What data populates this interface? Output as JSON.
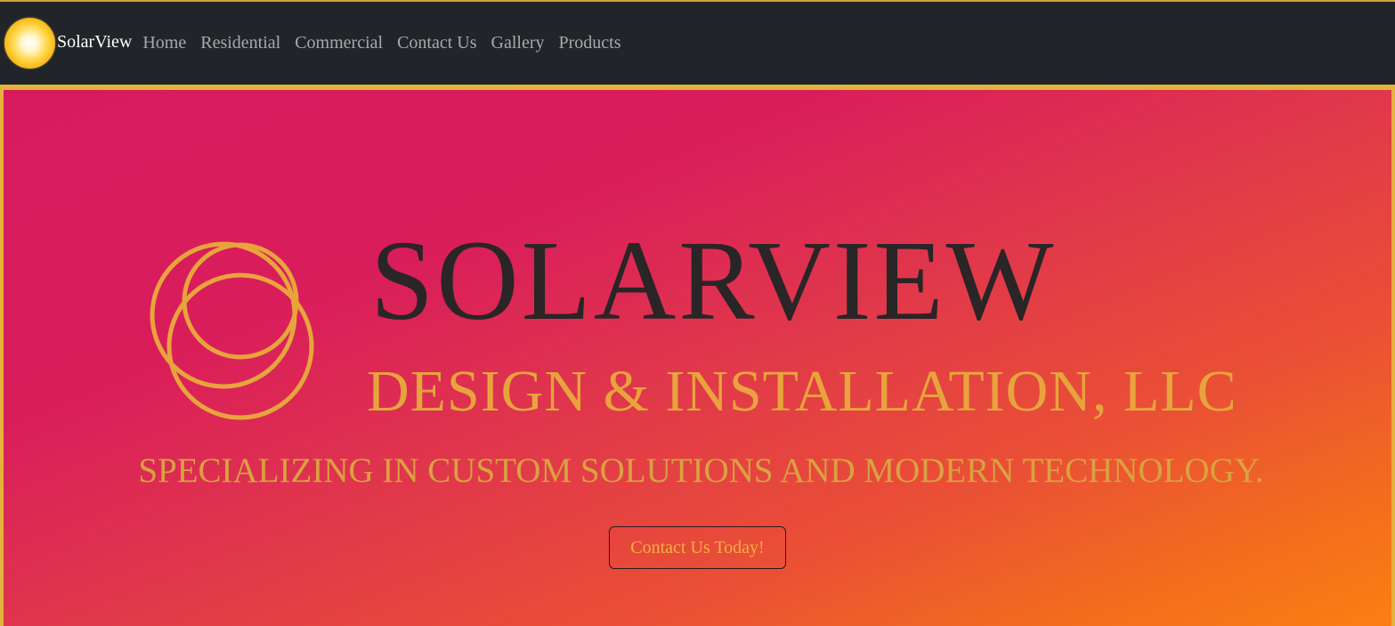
{
  "navbar": {
    "brand": {
      "icon": "sun-icon",
      "name": "SolarView"
    },
    "links": [
      {
        "label": "Home"
      },
      {
        "label": "Residential"
      },
      {
        "label": "Commercial"
      },
      {
        "label": "Contact Us"
      },
      {
        "label": "Gallery"
      },
      {
        "label": "Products"
      }
    ]
  },
  "hero": {
    "logo": {
      "icon": "overlapping-rings-icon",
      "title": "SOLARVIEW",
      "subtitle": "DESIGN & INSTALLATION, LLC"
    },
    "tagline": "SPECIALIZING IN CUSTOM SOLUTIONS AND MODERN TECHNOLOGY.",
    "cta_label": "Contact Us Today!"
  },
  "colors": {
    "navbar_bg": "#212529",
    "border_accent": "#e3b33c",
    "gradient_start": "#d81b5e",
    "gradient_end": "#fa7f12",
    "logo_title": "#2a2526",
    "logo_gold": "#e8a43c",
    "nav_link": "#a8a9ab"
  }
}
